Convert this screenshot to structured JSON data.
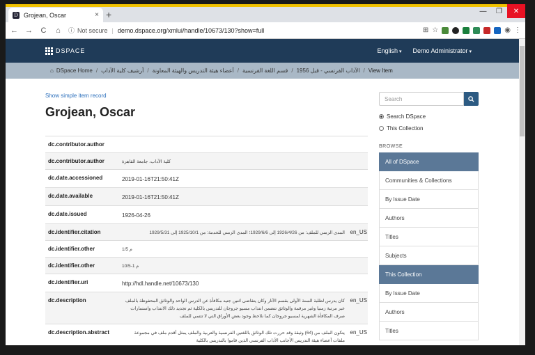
{
  "browser": {
    "tab_title": "Grojean, Oscar",
    "tab_favicon": "D",
    "tab_close": "×",
    "new_tab": "+",
    "window_controls": {
      "minimize": "—",
      "restore": "❐",
      "close": "✕"
    },
    "nav": {
      "back": "←",
      "forward": "→",
      "reload": "C",
      "home": "⌂"
    },
    "not_secure": "Not secure",
    "url": "demo.dspace.org/xmlui/handle/10673/130?show=full",
    "extension_colors": [
      "#4a8a3a",
      "#222222",
      "#1a7f3c",
      "#2e8b57",
      "#c62828",
      "#1565c0",
      "#3a8dde"
    ]
  },
  "header": {
    "logo_text": "DSPACE",
    "language": "English",
    "user": "Demo Administrator"
  },
  "breadcrumb": {
    "home": "DSpace Home",
    "items": [
      "أرشيف كلية الآداب",
      "أعضاء هيئة التدريس والهيئة المعاونة",
      "قسم اللغة الفرنسية",
      "الآداب الفرنسي - قبل 1956"
    ],
    "current": "View Item"
  },
  "main": {
    "simple_link": "Show simple item record",
    "title": "Grojean, Oscar",
    "rows": [
      {
        "key": "dc.contributor.author",
        "value": "",
        "lang": ""
      },
      {
        "key": "dc.contributor.author",
        "value": "كلية الآداب، جامعة القاهرة",
        "lang": ""
      },
      {
        "key": "dc.date.accessioned",
        "value": "2019-01-16T21:50:41Z",
        "lang": ""
      },
      {
        "key": "dc.date.available",
        "value": "2019-01-16T21:50:41Z",
        "lang": ""
      },
      {
        "key": "dc.date.issued",
        "value": "1926-04-26",
        "lang": ""
      },
      {
        "key": "dc.identifier.citation",
        "value": "المدى الزمني للملف: من 1926/4/26 إلى 1929/6/6؛ المدى الزمني للخدمة: من 1925/10/1 إلى 1929/5/31",
        "lang": "en_US"
      },
      {
        "key": "dc.identifier.other",
        "value": "م 1/5",
        "lang": ""
      },
      {
        "key": "dc.identifier.other",
        "value": "م 1-10/5",
        "lang": ""
      },
      {
        "key": "dc.identifier.uri",
        "value": "http://hdl.handle.net/10673/130",
        "lang": ""
      },
      {
        "key": "dc.description",
        "value": "كان يدرس لطلبة السنة الأولى بقسم الآثار وكان يتقاضى اثنين جنيه مكافأة عن الدرس الواحد والوثائق المحفوظة بالملف عبر مرتبة زمنيا وغير مرقمة والوثائق تتضمن انتداب مسيو جروجان للتدريس بالكلية ثم تجديد ذلك الانتداب واستمارات صرف المكافأة الشهرية لمسيو جروجان كما نلاحظ وجود بعض الأوراق التي لا تتتمي للملف",
        "lang": "en_US"
      },
      {
        "key": "dc.description.abstract",
        "value": "يتكون الملف من (64) وثيقة وقد حررت تلك الوثائق باللغتين الفرنسية والعربية والملف يمثل أقدم ملف في مجموعة ملفات أعضاء هيئة التدريس الأجانب الآداب الفرنسي الذين قاموا بالتدريس بالكلية",
        "lang": "en_US"
      }
    ]
  },
  "sidebar": {
    "search_placeholder": "Search",
    "radio_all": "Search DSpace",
    "radio_collection": "This Collection",
    "browse_heading": "BROWSE",
    "items": [
      {
        "label": "All of DSpace",
        "active": true
      },
      {
        "label": "Communities & Collections",
        "active": false
      },
      {
        "label": "By Issue Date",
        "active": false
      },
      {
        "label": "Authors",
        "active": false
      },
      {
        "label": "Titles",
        "active": false
      },
      {
        "label": "Subjects",
        "active": false
      },
      {
        "label": "This Collection",
        "active": true
      },
      {
        "label": "By Issue Date",
        "active": false
      },
      {
        "label": "Authors",
        "active": false
      },
      {
        "label": "Titles",
        "active": false
      }
    ]
  }
}
